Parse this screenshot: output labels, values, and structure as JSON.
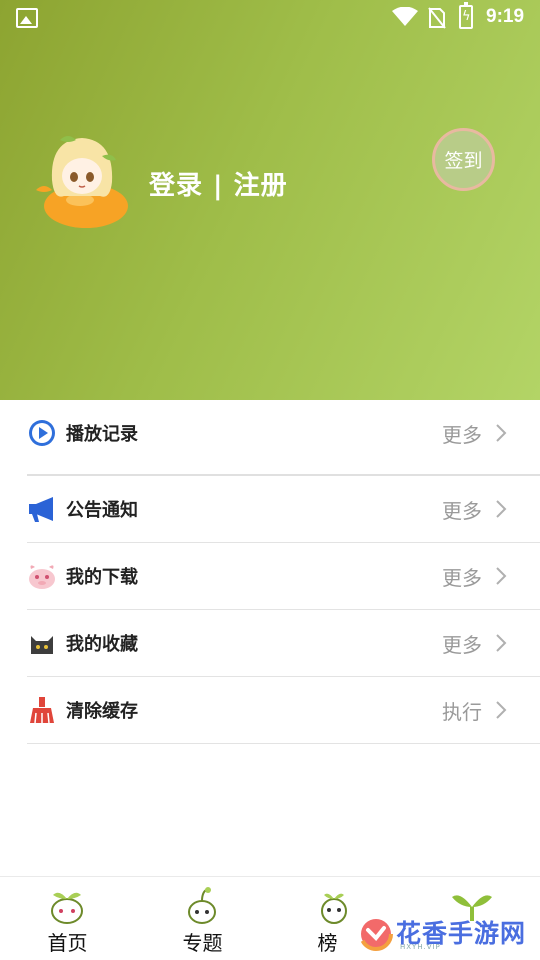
{
  "status_bar": {
    "time": "9:19"
  },
  "profile": {
    "login_register": "登录 | 注册",
    "checkin_label": "签到"
  },
  "menu": {
    "items": [
      {
        "label": "播放记录",
        "action": "更多",
        "icon": "play-circle-icon",
        "color": "#2f6fdb"
      },
      {
        "label": "公告通知",
        "action": "更多",
        "icon": "megaphone-icon",
        "color": "#2b63d6"
      },
      {
        "label": "我的下载",
        "action": "更多",
        "icon": "pink-creature-icon",
        "color": "#f2a9b5"
      },
      {
        "label": "我的收藏",
        "action": "更多",
        "icon": "black-cat-icon",
        "color": "#3d3d3d"
      },
      {
        "label": "清除缓存",
        "action": "执行",
        "icon": "broom-icon",
        "color": "#e0453a"
      }
    ]
  },
  "bottom_nav": {
    "tabs": [
      {
        "label": "首页",
        "icon": "sprout-home-icon"
      },
      {
        "label": "专题",
        "icon": "sprout-topic-icon"
      },
      {
        "label": "榜",
        "icon": "sprout-rank-icon"
      },
      {
        "label": "",
        "icon": "sprout-profile-icon"
      }
    ]
  },
  "watermark": {
    "text": "花香手游网",
    "subtext": "HXYH.VIP"
  },
  "colors": {
    "header_start": "#8da431",
    "header_end": "#b3d466",
    "accent": "#8fb13a"
  }
}
